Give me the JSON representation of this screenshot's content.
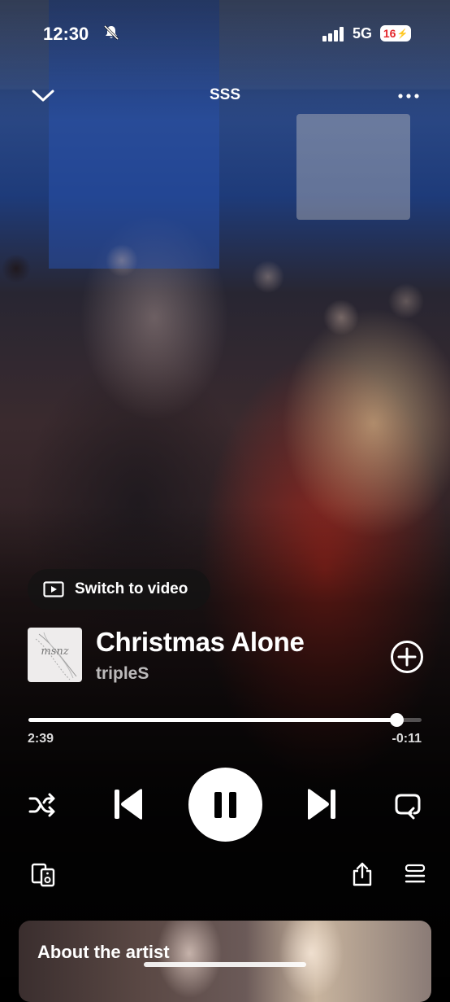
{
  "status_bar": {
    "time": "12:30",
    "network": "5G",
    "battery": "16",
    "icons": [
      "bell-slash-icon",
      "signal-bars-icon",
      "battery-charging-icon"
    ]
  },
  "header": {
    "title": "SSS",
    "icons": [
      "chevron-down-icon",
      "more-horizontal-icon"
    ]
  },
  "switch_video": {
    "label": "Switch to video",
    "icon": "video-icon"
  },
  "track": {
    "title": "Christmas Alone",
    "artist": "tripleS",
    "album_art_text": "msnz"
  },
  "progress": {
    "elapsed": "2:39",
    "remaining": "-0:11",
    "fraction": 0.935
  },
  "controls": {
    "icons": [
      "shuffle-icon",
      "previous-icon",
      "pause-icon",
      "next-icon",
      "repeat-icon",
      "add-circle-icon",
      "connect-device-icon",
      "share-icon",
      "queue-icon"
    ]
  },
  "about": {
    "title": "About the artist"
  },
  "colors": {
    "accent": "#ffffff",
    "battery_text": "#e3262b"
  }
}
